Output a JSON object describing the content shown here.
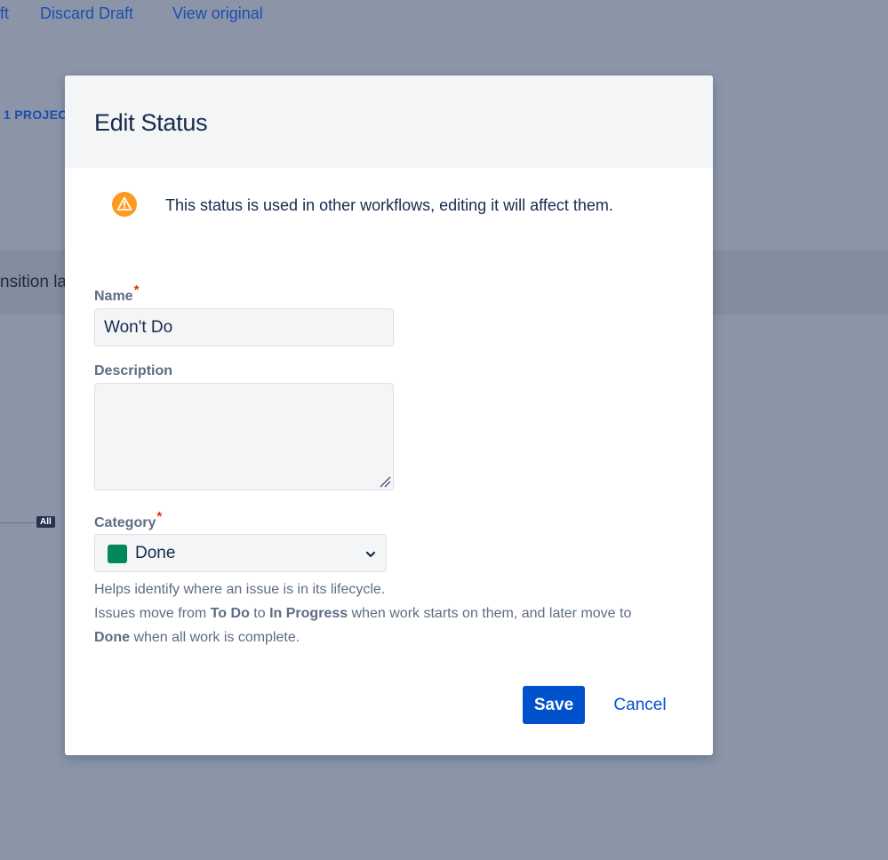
{
  "background": {
    "top_links": [
      "ft",
      "Discard Draft",
      "View original"
    ],
    "projects_label": "1 PROJEC",
    "band_text": "nsition la",
    "all_badge": "All"
  },
  "dialog": {
    "title": "Edit Status",
    "warning": {
      "icon": "warning-triangle-icon",
      "text": "This status is used in other workflows, editing it will affect them."
    },
    "name": {
      "label": "Name",
      "required_mark": "*",
      "value": "Won't Do"
    },
    "description": {
      "label": "Description",
      "value": ""
    },
    "category": {
      "label": "Category",
      "required_mark": "*",
      "selected": "Done",
      "swatch_color": "#00875a",
      "icon": "chevron-down-icon"
    },
    "help": {
      "line1": "Helps identify where an issue is in its lifecycle.",
      "line2_prefix": "Issues move from ",
      "line2_todo": "To Do",
      "line2_to": " to ",
      "line2_inprogress": "In Progress",
      "line2_suffix": " when work starts on them, and later move to ",
      "line3_done": "Done",
      "line3_suffix": " when all work is complete."
    },
    "save_label": "Save",
    "cancel_label": "Cancel"
  },
  "colors": {
    "overlay": "#8c95a8",
    "primary": "#0052cc",
    "warning": "#ff991f",
    "required": "#de350b"
  }
}
